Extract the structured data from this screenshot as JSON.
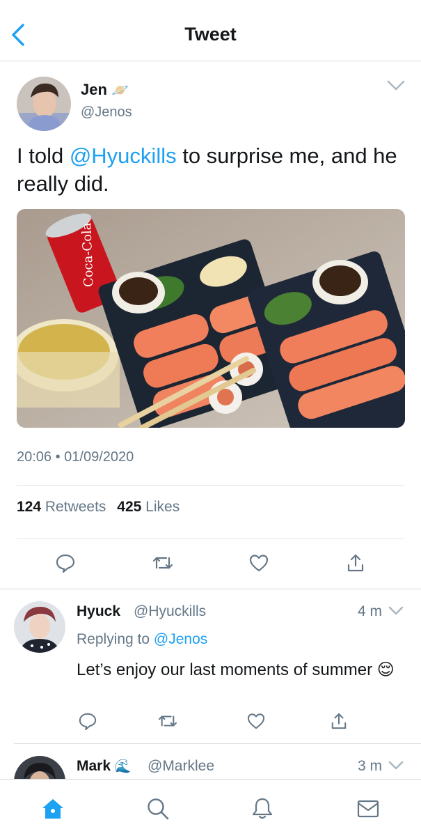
{
  "header": {
    "title": "Tweet"
  },
  "tweet": {
    "author_name": "Jen",
    "author_emoji": "🪐",
    "author_handle": "@Jenos",
    "text_before": "I told ",
    "text_mention": "@Hyuckills",
    "text_after": " to surprise me, and he really did.",
    "timestamp": "20:06 • 01/09/2020",
    "retweets_count": "124",
    "retweets_label": "Retweets",
    "likes_count": "425",
    "likes_label": "Likes"
  },
  "replies": [
    {
      "name": "Hyuck",
      "handle": "@Hyuckills",
      "time": "4 m",
      "replying_label": "Replying to",
      "replying_to": "@Jenos",
      "text": "Let’s enjoy our last moments of summer",
      "emoji": "😌"
    },
    {
      "name": "Mark",
      "emoji": "🌊",
      "handle": "@Marklee",
      "time": "3 m"
    }
  ],
  "icons": {
    "back": "chevron-left-icon",
    "reply": "reply-icon",
    "retweet": "retweet-icon",
    "like": "heart-icon",
    "share": "share-icon",
    "home": "home-icon",
    "search": "search-icon",
    "notifications": "bell-icon",
    "messages": "mail-icon"
  },
  "colors": {
    "accent": "#1da1f2",
    "secondary_text": "#657786",
    "divider": "#e1e8ed"
  }
}
